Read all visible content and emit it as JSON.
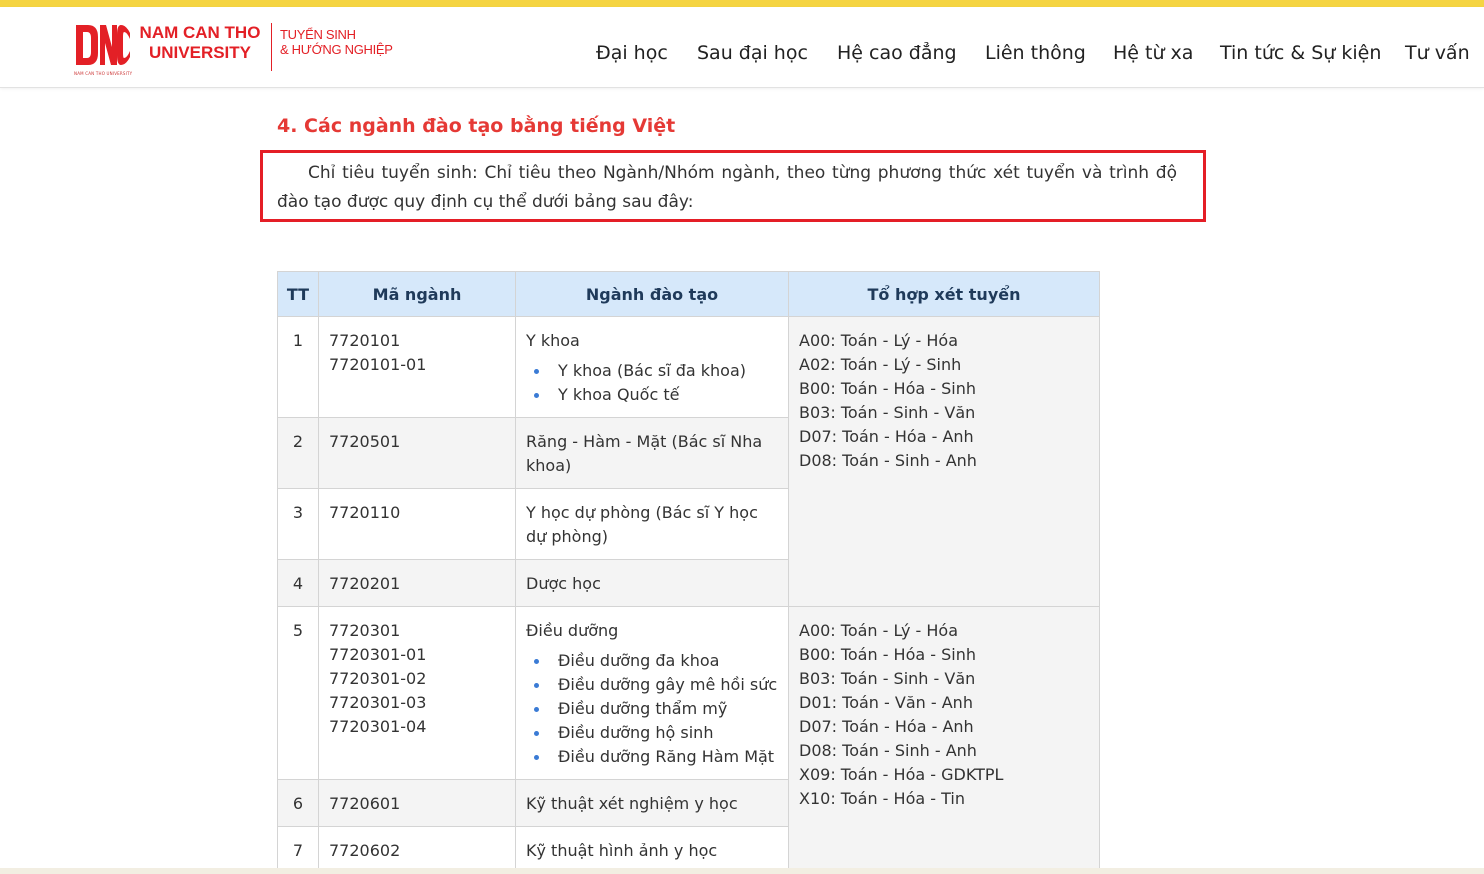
{
  "header": {
    "logo": {
      "mark_text": "DNC",
      "mark_caption": "NAM CAN THO UNIVERSITY",
      "name_line1": "NAM CAN THO",
      "name_line2": "UNIVERSITY",
      "tag_line1": "TUYỂN SINH",
      "tag_line2": "& HƯỚNG NGHIỆP"
    },
    "nav": [
      "Đại học",
      "Sau đại học",
      "Hệ cao đẳng",
      "Liên thông",
      "Hệ từ xa",
      "Tin tức & Sự kiện",
      "Tư vấn"
    ]
  },
  "main": {
    "section_title": "4. Các ngành đào tạo bằng tiếng Việt",
    "intro": "Chỉ tiêu tuyển sinh: Chỉ tiêu theo Ngành/Nhóm ngành, theo từng phương thức xét tuyển và trình độ đào tạo được quy định cụ thể dưới bảng sau đây:",
    "table": {
      "headers": [
        "TT",
        "Mã ngành",
        "Ngành đào tạo",
        "Tổ hợp xét tuyển"
      ],
      "rows": [
        {
          "tt": "1",
          "codes": [
            "7720101",
            "7720101-01"
          ],
          "major": "Y khoa",
          "subs": [
            "Y khoa (Bác sĩ đa khoa)",
            "Y khoa Quốc tế"
          ]
        },
        {
          "tt": "2",
          "codes": [
            "7720501"
          ],
          "major": "Răng - Hàm - Mặt (Bác sĩ Nha khoa)",
          "subs": []
        },
        {
          "tt": "3",
          "codes": [
            "7720110"
          ],
          "major": "Y học dự phòng (Bác sĩ Y học dự phòng)",
          "subs": []
        },
        {
          "tt": "4",
          "codes": [
            "7720201"
          ],
          "major": "Dược học",
          "subs": []
        },
        {
          "tt": "5",
          "codes": [
            "7720301",
            "7720301-01",
            "7720301-02",
            "7720301-03",
            "7720301-04"
          ],
          "major": "Điều dưỡng",
          "subs": [
            "Điều dưỡng đa khoa",
            "Điều dưỡng gây mê hồi sức",
            "Điều dưỡng thẩm mỹ",
            "Điều dưỡng hộ sinh",
            "Điều dưỡng Răng Hàm Mặt"
          ]
        },
        {
          "tt": "6",
          "codes": [
            "7720601"
          ],
          "major": "Kỹ thuật xét nghiệm y học",
          "subs": []
        },
        {
          "tt": "7",
          "codes": [
            "7720602"
          ],
          "major": "Kỹ thuật hình ảnh y học",
          "subs": []
        }
      ],
      "combos_group1": [
        "A00: Toán - Lý - Hóa",
        "A02: Toán - Lý - Sinh",
        "B00: Toán - Hóa - Sinh",
        "B03: Toán - Sinh - Văn",
        "D07: Toán - Hóa - Anh",
        "D08: Toán - Sinh - Anh"
      ],
      "combos_group2": [
        "A00: Toán - Lý - Hóa",
        "B00: Toán - Hóa - Sinh",
        "B03: Toán - Sinh - Văn",
        "D01: Toán - Văn - Anh",
        "D07: Toán - Hóa - Anh",
        "D08: Toán - Sinh - Anh",
        "X09: Toán - Hóa - GDKTPL",
        "X10: Toán - Hóa - Tin"
      ]
    }
  },
  "colors": {
    "brand_red": "#e32026",
    "topbar_yellow": "#f5d442",
    "table_header_bg": "#d6e8fa",
    "bullet_blue": "#3a7bd5"
  }
}
